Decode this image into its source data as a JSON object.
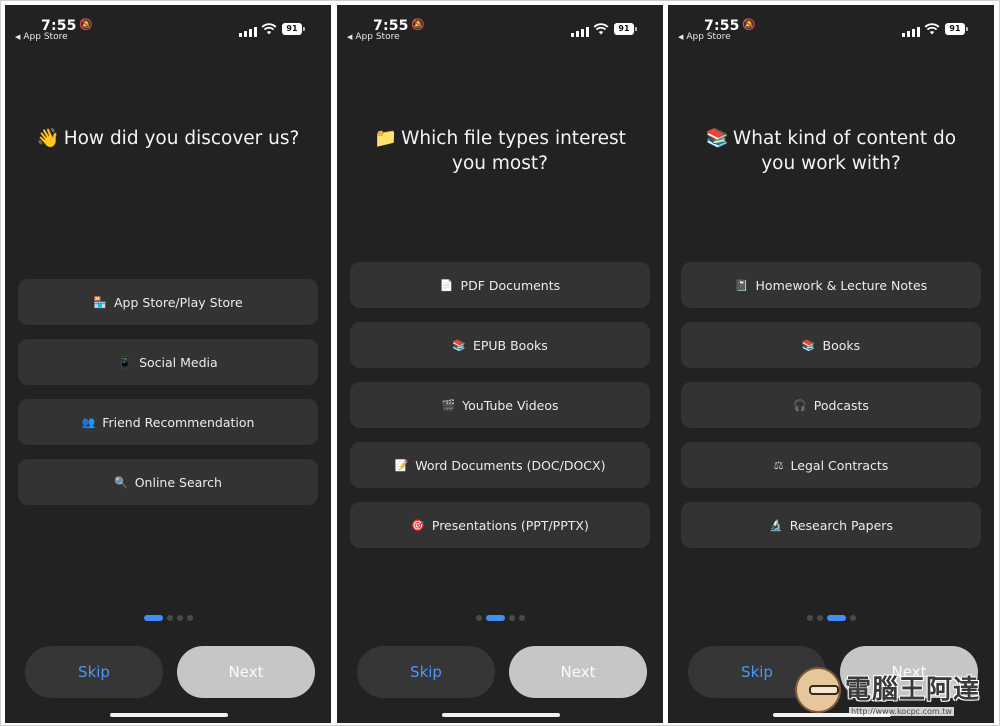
{
  "status": {
    "time": "7:55",
    "back_label": "App Store",
    "battery": "91"
  },
  "screens": [
    {
      "question_emoji": "👋",
      "question": "How did you discover us?",
      "options": [
        {
          "icon": "🏪",
          "icon_name": "store-icon",
          "label": "App Store/Play Store"
        },
        {
          "icon": "📱",
          "icon_name": "phone-icon",
          "label": "Social Media"
        },
        {
          "icon": "👥",
          "icon_name": "people-icon",
          "label": "Friend Recommendation"
        },
        {
          "icon": "🔍",
          "icon_name": "search-icon",
          "label": "Online Search"
        }
      ],
      "active_dot": 0
    },
    {
      "question_emoji": "📁",
      "question": "Which file types interest you most?",
      "options": [
        {
          "icon": "📄",
          "icon_name": "document-icon",
          "label": "PDF Documents"
        },
        {
          "icon": "📚",
          "icon_name": "books-icon",
          "label": "EPUB Books"
        },
        {
          "icon": "🎬",
          "icon_name": "video-icon",
          "label": "YouTube Videos"
        },
        {
          "icon": "📝",
          "icon_name": "memo-icon",
          "label": "Word Documents (DOC/DOCX)"
        },
        {
          "icon": "🎯",
          "icon_name": "target-icon",
          "label": "Presentations (PPT/PPTX)"
        }
      ],
      "active_dot": 1
    },
    {
      "question_emoji": "📚",
      "question": "What kind of content do you work with?",
      "options": [
        {
          "icon": "📓",
          "icon_name": "notebook-icon",
          "label": "Homework & Lecture Notes"
        },
        {
          "icon": "📚",
          "icon_name": "books-icon",
          "label": "Books"
        },
        {
          "icon": "🎧",
          "icon_name": "headphones-icon",
          "label": "Podcasts"
        },
        {
          "icon": "⚖",
          "icon_name": "scales-icon",
          "label": "Legal Contracts"
        },
        {
          "icon": "🔬",
          "icon_name": "microscope-icon",
          "label": "Research Papers"
        }
      ],
      "active_dot": 2
    }
  ],
  "buttons": {
    "skip": "Skip",
    "next": "Next"
  },
  "watermark": {
    "text": "電腦王阿達",
    "url": "http://www.kocpc.com.tw"
  },
  "colors": {
    "background": "#222222",
    "option_bg": "#333333",
    "accent": "#3f8ff5",
    "next_bg": "#c6c6c6"
  }
}
